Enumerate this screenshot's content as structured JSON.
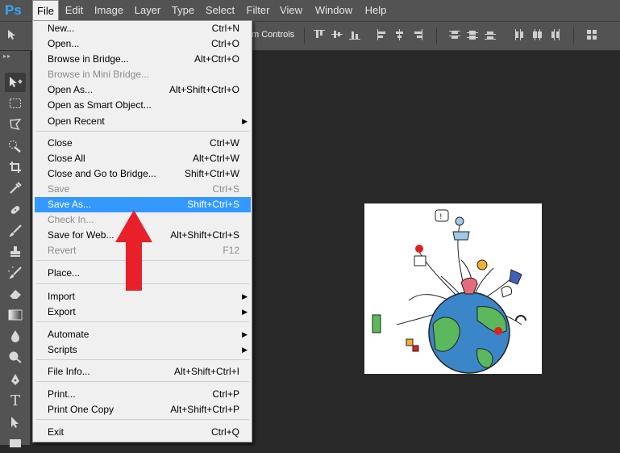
{
  "app": {
    "logo": "Ps"
  },
  "menubar": {
    "items": [
      {
        "label": "File",
        "active": true
      },
      {
        "label": "Edit"
      },
      {
        "label": "Image"
      },
      {
        "label": "Layer"
      },
      {
        "label": "Type"
      },
      {
        "label": "Select"
      },
      {
        "label": "Filter"
      },
      {
        "label": "View"
      },
      {
        "label": "Window"
      },
      {
        "label": "Help"
      }
    ]
  },
  "options_bar": {
    "label": "m Controls"
  },
  "file_menu": {
    "items": [
      {
        "label": "New...",
        "shortcut": "Ctrl+N"
      },
      {
        "label": "Open...",
        "shortcut": "Ctrl+O"
      },
      {
        "label": "Browse in Bridge...",
        "shortcut": "Alt+Ctrl+O"
      },
      {
        "label": "Browse in Mini Bridge...",
        "shortcut": "",
        "disabled": true
      },
      {
        "label": "Open As...",
        "shortcut": "Alt+Shift+Ctrl+O"
      },
      {
        "label": "Open as Smart Object...",
        "shortcut": ""
      },
      {
        "label": "Open Recent",
        "shortcut": "",
        "submenu": true
      },
      {
        "label": "Close",
        "shortcut": "Ctrl+W"
      },
      {
        "label": "Close All",
        "shortcut": "Alt+Ctrl+W"
      },
      {
        "label": "Close and Go to Bridge...",
        "shortcut": "Shift+Ctrl+W"
      },
      {
        "label": "Save",
        "shortcut": "Ctrl+S",
        "disabled": true
      },
      {
        "label": "Save As...",
        "shortcut": "Shift+Ctrl+S",
        "highlighted": true
      },
      {
        "label": "Check In...",
        "shortcut": "",
        "disabled": true
      },
      {
        "label": "Save for Web...",
        "shortcut": "Alt+Shift+Ctrl+S"
      },
      {
        "label": "Revert",
        "shortcut": "F12",
        "disabled": true
      },
      {
        "label": "Place...",
        "shortcut": ""
      },
      {
        "label": "Import",
        "shortcut": "",
        "submenu": true
      },
      {
        "label": "Export",
        "shortcut": "",
        "submenu": true
      },
      {
        "label": "Automate",
        "shortcut": "",
        "submenu": true
      },
      {
        "label": "Scripts",
        "shortcut": "",
        "submenu": true
      },
      {
        "label": "File Info...",
        "shortcut": "Alt+Shift+Ctrl+I"
      },
      {
        "label": "Print...",
        "shortcut": "Ctrl+P"
      },
      {
        "label": "Print One Copy",
        "shortcut": "Alt+Shift+Ctrl+P"
      },
      {
        "label": "Exit",
        "shortcut": "Ctrl+Q"
      }
    ]
  },
  "annotation": {
    "color": "#e8202a"
  },
  "colors": {
    "menu_highlight": "#3399ff",
    "ps_blue": "#31a8ff"
  }
}
